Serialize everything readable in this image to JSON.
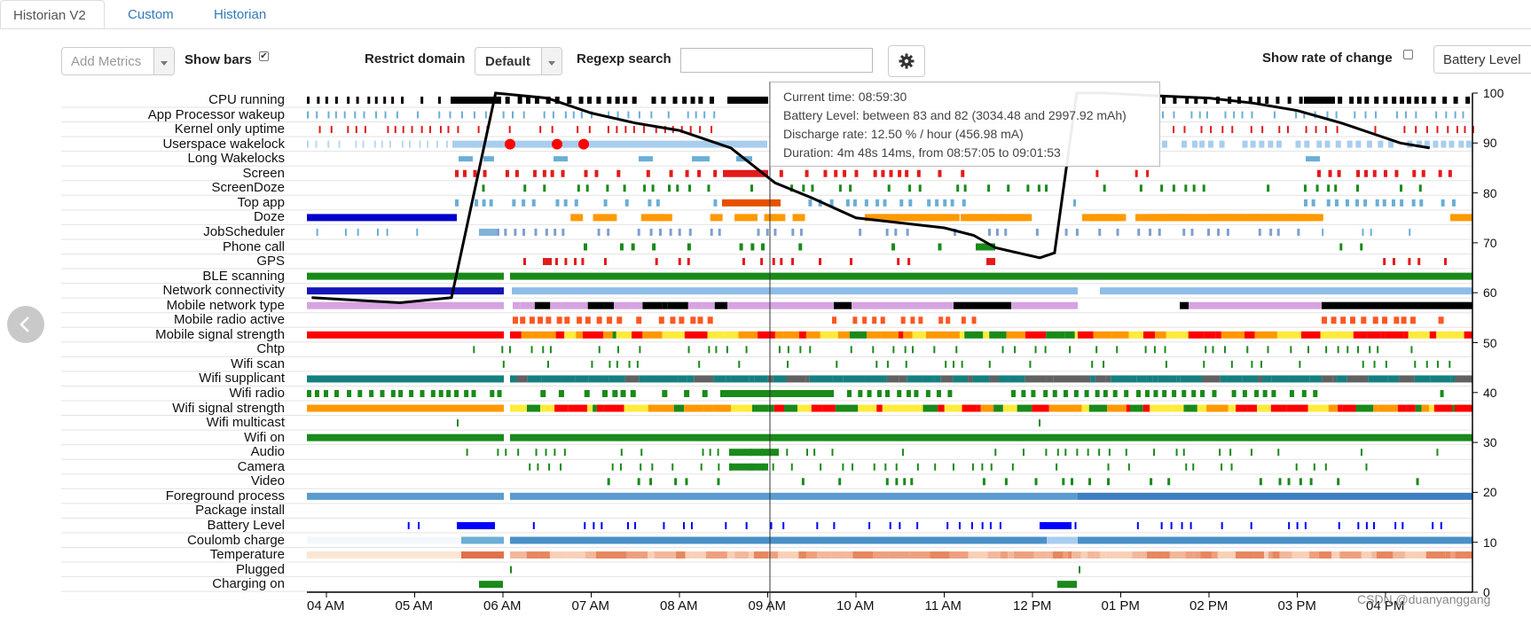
{
  "tabs": [
    {
      "label": "Historian V2",
      "active": true
    },
    {
      "label": "Custom",
      "active": false
    },
    {
      "label": "Historian",
      "active": false
    }
  ],
  "toolbar": {
    "add_metrics_placeholder": "Add Metrics",
    "show_bars_label": "Show bars",
    "show_bars_checked": true,
    "restrict_domain_label": "Restrict domain",
    "restrict_domain_value": "Default",
    "regexp_label": "Regexp search",
    "regexp_value": "",
    "settings_icon": "gear-icon",
    "show_rate_label": "Show rate of change",
    "show_rate_checked": false,
    "overlay_metric_value": "Battery Level"
  },
  "rows": [
    "CPU running",
    "App Processor wakeup",
    "Kernel only uptime",
    "Userspace wakelock",
    "Long Wakelocks",
    "Screen",
    "ScreenDoze",
    "Top app",
    "Doze",
    "JobScheduler",
    "Phone call",
    "GPS",
    "BLE scanning",
    "Network connectivity",
    "Mobile network type",
    "Mobile radio active",
    "Mobile signal strength",
    "Chtp",
    "Wifi scan",
    "Wifi supplicant",
    "Wifi radio",
    "Wifi signal strength",
    "Wifi multicast",
    "Wifi on",
    "Audio",
    "Camera",
    "Video",
    "Foreground process",
    "Package install",
    "Battery Level",
    "Coulomb charge",
    "Temperature",
    "Plugged",
    "Charging on"
  ],
  "x_ticks": [
    "04 AM",
    "05 AM",
    "06 AM",
    "07 AM",
    "08 AM",
    "09 AM",
    "10 AM",
    "11 AM",
    "12 PM",
    "01 PM",
    "02 PM",
    "03 PM",
    "04 PM"
  ],
  "y_ticks": [
    "100",
    "90",
    "80",
    "70",
    "60",
    "50",
    "40",
    "30",
    "20",
    "10",
    "0"
  ],
  "tooltip": {
    "current_time": "Current time: 08:59:30",
    "battery_level": "Battery Level: between 83 and 82 (3034.48 and 2997.92 mAh)",
    "discharge_rate": "Discharge rate: 12.50 % / hour (456.98 mA)",
    "duration": "Duration: 4m 48s 14ms, from 08:57:05 to 09:01:53"
  },
  "watermark": "CSDN @duanyanggang",
  "colors": {
    "cpu": "#000000",
    "wake": "#6baed6",
    "screen_red": "#e31a1c",
    "green": "#1a8a1a",
    "doze_blue": "#0000cc",
    "doze_orange": "#ff9900",
    "mobile_purple": "#d6a3e0",
    "teal": "#138080",
    "light_blue": "#8fbde8",
    "fg_blue": "#5a9bd0",
    "battery_blue": "#0000ff"
  },
  "chart_data": {
    "type": "line",
    "series": [
      {
        "name": "Battery Level",
        "x": [
          "03:50",
          "04:20",
          "04:50",
          "05:25",
          "05:55",
          "06:30",
          "07:00",
          "07:30",
          "08:00",
          "08:35",
          "09:05",
          "09:30",
          "10:00",
          "10:30",
          "11:00",
          "11:20",
          "11:35",
          "11:50",
          "12:05",
          "12:15",
          "12:30",
          "12:50",
          "13:20",
          "14:00",
          "14:30",
          "15:00",
          "15:30",
          "15:50",
          "16:10",
          "16:30"
        ],
        "y": [
          59,
          58.5,
          58,
          59,
          100,
          99,
          96,
          94,
          92.5,
          89,
          82,
          79,
          75,
          74,
          73,
          71.5,
          69,
          68,
          67,
          68,
          100,
          100,
          99.5,
          99,
          98,
          96.5,
          94,
          92,
          90,
          89
        ]
      }
    ],
    "ylabel": "",
    "ylim": [
      0,
      100
    ],
    "xlim": [
      "03:50",
      "17:00"
    ]
  }
}
